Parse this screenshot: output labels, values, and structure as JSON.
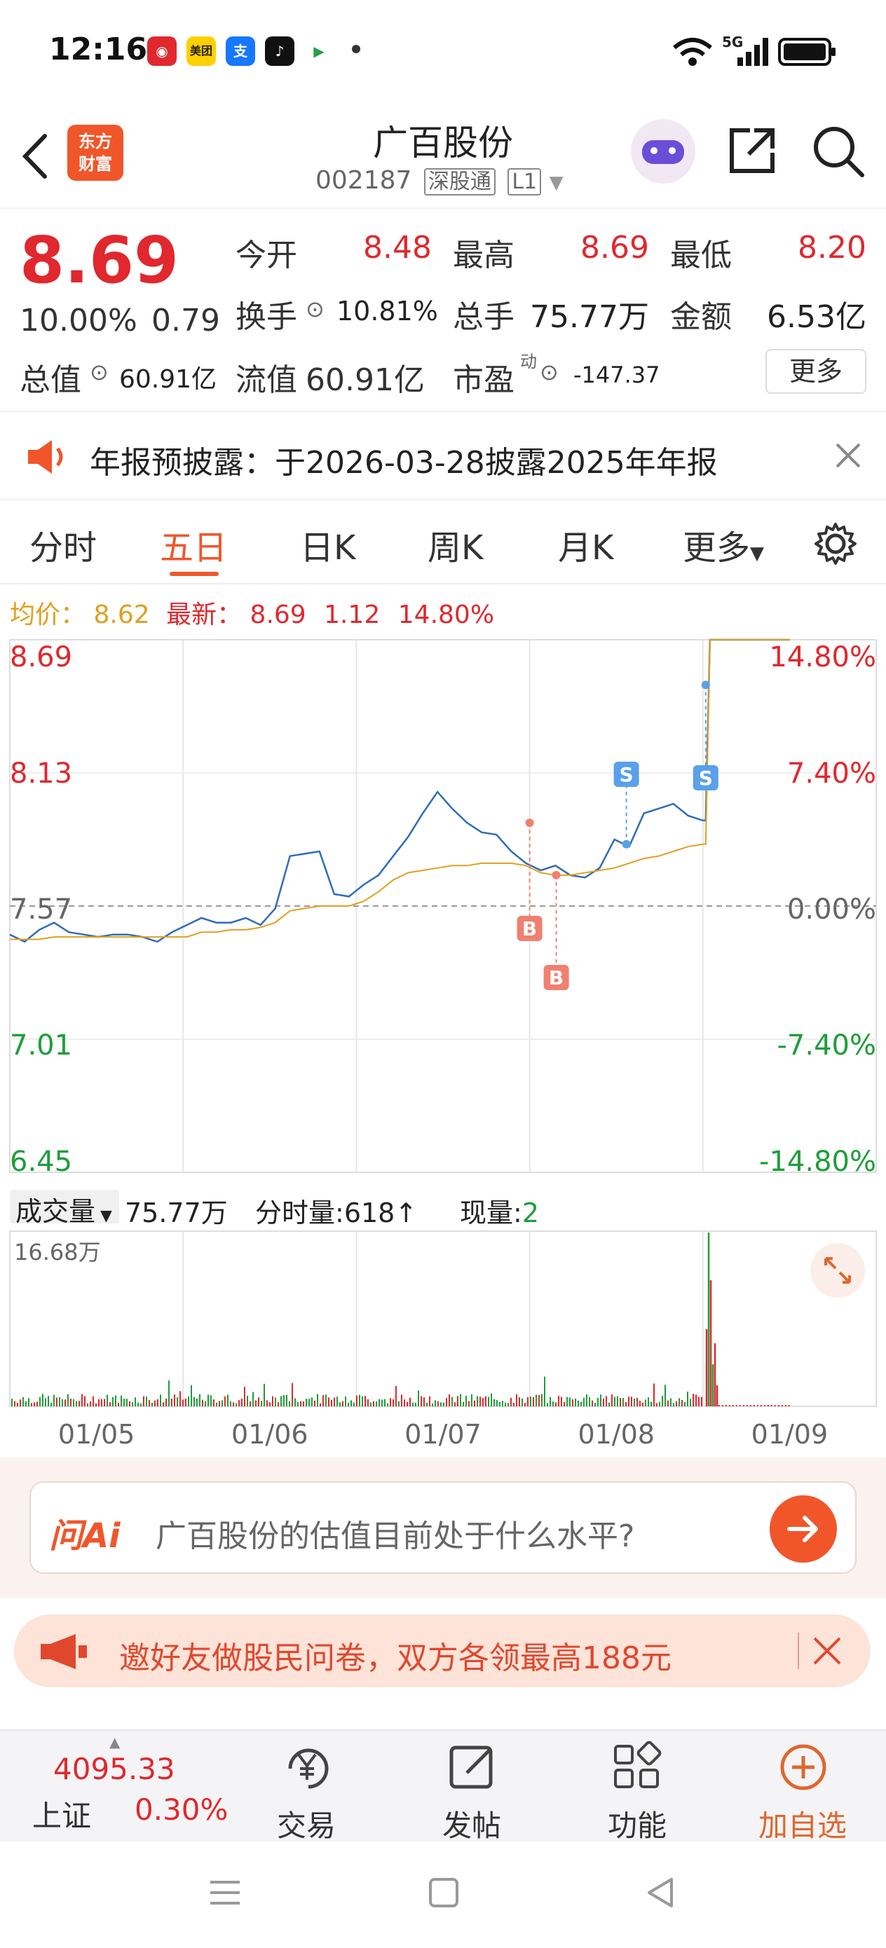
{
  "status_bar": {
    "time": "12:16",
    "apps": [
      "网易云",
      "美团",
      "支",
      "抖音",
      "人人"
    ],
    "network": "5G",
    "icons": [
      "wifi-icon",
      "signal-icon",
      "battery-icon"
    ]
  },
  "header": {
    "logo_line1": "东方",
    "logo_line2": "财富",
    "stock_name": "广百股份",
    "stock_code": "002187",
    "tag_market": "深股通",
    "tag_level": "L1"
  },
  "quote": {
    "price": "8.69",
    "change_pct": "10.00%",
    "change_amt": "0.79",
    "open_label": "今开",
    "open_val": "8.48",
    "high_label": "最高",
    "high_val": "8.69",
    "low_label": "最低",
    "low_val": "8.20",
    "turnover_label": "换手",
    "turnover_val": "10.81%",
    "volume_label": "总手",
    "volume_val": "75.77万",
    "amount_label": "金额",
    "amount_val": "6.53亿",
    "mktcap_label": "总值",
    "mktcap_val": "60.91亿",
    "float_label": "流值",
    "float_val": "60.91亿",
    "pe_label": "市盈",
    "pe_sup": "动",
    "pe_val": "-147.37",
    "more_label": "更多"
  },
  "notice": {
    "text": "年报预披露：于2026-03-28披露2025年年报"
  },
  "tabs": [
    {
      "label": "分时"
    },
    {
      "label": "五日"
    },
    {
      "label": "日K"
    },
    {
      "label": "周K"
    },
    {
      "label": "月K"
    },
    {
      "label": "更多"
    }
  ],
  "avg_line": {
    "avg_label": "均价：",
    "avg_val": "8.62",
    "latest_label": "最新：",
    "latest_val": "8.69",
    "latest_chg": "1.12",
    "latest_pct": "14.80%"
  },
  "volume_row": {
    "label": "成交量",
    "total": "75.77万",
    "tick_label": "分时量:",
    "tick_val": "618",
    "now_label": "现量:",
    "now_val": "2",
    "max_label": "16.68万"
  },
  "chart_data": {
    "type": "line",
    "y_left_ticks": [
      "8.69",
      "8.13",
      "7.57",
      "7.01",
      "6.45"
    ],
    "y_right_ticks": [
      "14.80%",
      "7.40%",
      "0.00%",
      "-7.40%",
      "-14.80%"
    ],
    "x_ticks": [
      "01/05",
      "01/06",
      "01/07",
      "01/08",
      "01/09"
    ],
    "ylim": [
      6.45,
      8.69
    ],
    "base_price": 7.57,
    "series": [
      {
        "color": "#2f6db5",
        "values": [
          7.45,
          7.42,
          7.47,
          7.5,
          7.46,
          7.45,
          7.44,
          7.45,
          7.45,
          7.44,
          7.42,
          7.46,
          7.49,
          7.52,
          7.5,
          7.5,
          7.52,
          7.49,
          7.56,
          7.78,
          7.79,
          7.8,
          7.62,
          7.61,
          7.66,
          7.7,
          7.78,
          7.86,
          7.96,
          8.05,
          7.98,
          7.92,
          7.88,
          7.87,
          7.8,
          7.75,
          7.72,
          7.74,
          7.7,
          7.69,
          7.73,
          7.85,
          7.82,
          7.96,
          7.98,
          8.0,
          7.95,
          7.93
        ]
      },
      {
        "color": "#e0a020",
        "values": [
          7.43,
          7.43,
          7.43,
          7.44,
          7.44,
          7.44,
          7.44,
          7.44,
          7.44,
          7.44,
          7.44,
          7.44,
          7.44,
          7.46,
          7.46,
          7.47,
          7.47,
          7.48,
          7.5,
          7.55,
          7.56,
          7.57,
          7.57,
          7.57,
          7.59,
          7.63,
          7.68,
          7.71,
          7.72,
          7.73,
          7.74,
          7.74,
          7.75,
          7.75,
          7.75,
          7.74,
          7.71,
          7.7,
          7.7,
          7.71,
          7.72,
          7.73,
          7.75,
          7.77,
          7.78,
          7.8,
          7.82,
          7.83
        ]
      }
    ],
    "markers": [
      {
        "label": "B",
        "color": "#f08070"
      },
      {
        "label": "B",
        "color": "#f08070"
      },
      {
        "label": "S",
        "color": "#5aa0ea"
      },
      {
        "label": "S",
        "color": "#5aa0ea"
      }
    ]
  },
  "ai_box": {
    "logo": "问Ai",
    "question": "广百股份的估值目前处于什么水平?"
  },
  "promo": {
    "text": "邀好友做股民问卷，双方各领最高188元"
  },
  "bottom_nav": {
    "index_value": "4095.33",
    "index_name": "上证",
    "index_pct": "0.30%",
    "trade": "交易",
    "post": "发帖",
    "func": "功能",
    "add": "加自选"
  }
}
